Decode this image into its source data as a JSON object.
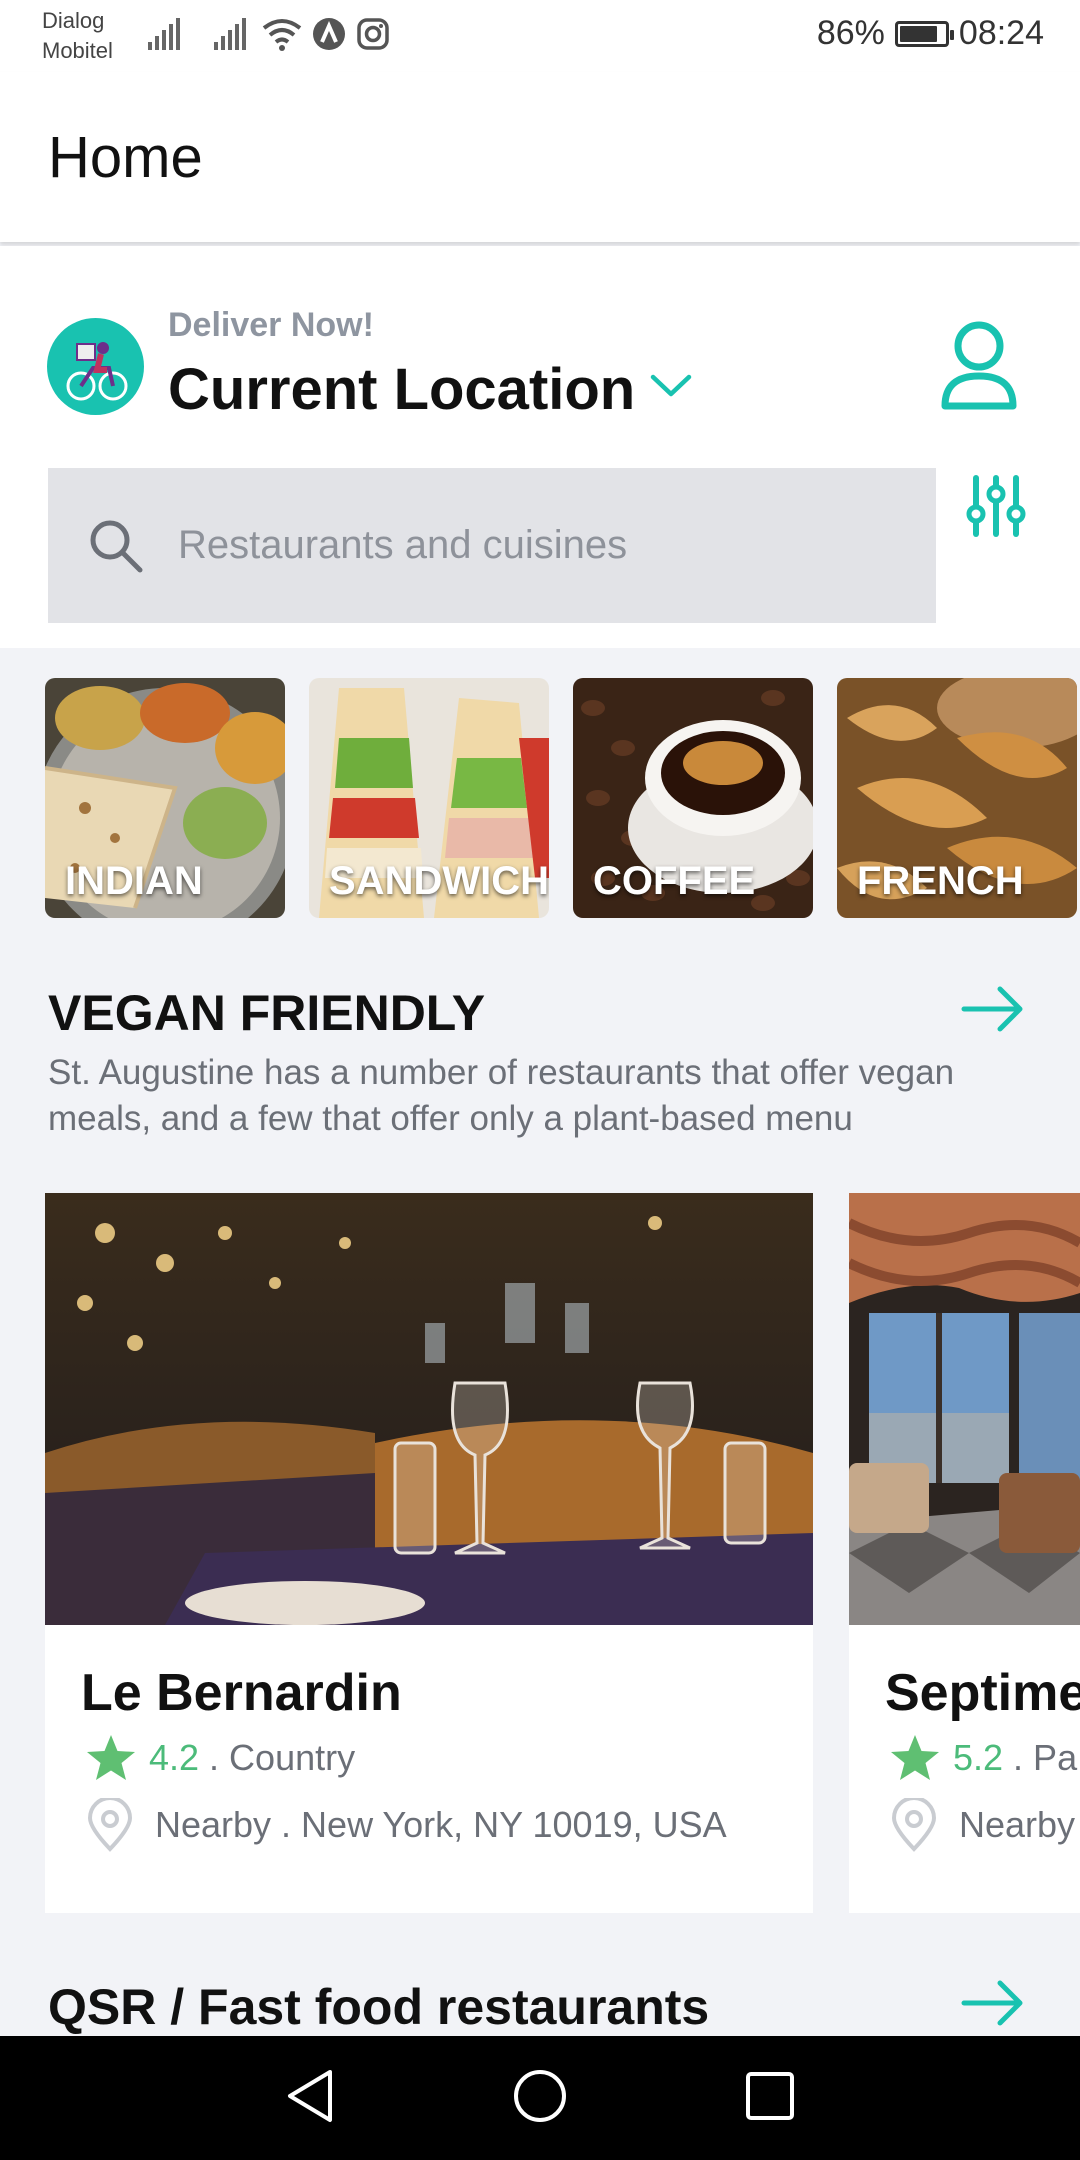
{
  "status_bar": {
    "carrier_line1": "Dialog",
    "carrier_line2": "Mobitel",
    "battery_text": "86%",
    "battery_level": 0.86,
    "time": "08:24"
  },
  "app_bar": {
    "title": "Home"
  },
  "header": {
    "deliver_label": "Deliver Now!",
    "location": "Current Location"
  },
  "search": {
    "placeholder": "Restaurants and cuisines"
  },
  "categories": [
    {
      "label": "INDIAN"
    },
    {
      "label": "SANDWICH"
    },
    {
      "label": "COFFEE"
    },
    {
      "label": "FRENCH"
    }
  ],
  "vegan_section": {
    "title": "VEGAN FRIENDLY",
    "description": "St. Augustine has a number of restaurants that offer vegan meals, and a few that offer only a plant-based menu"
  },
  "restaurants": [
    {
      "name": "Le Bernardin",
      "rating": "4.2",
      "category": ". Country",
      "location": "Nearby . New York, NY 10019, USA"
    },
    {
      "name": "Septime",
      "rating": "5.2",
      "category": ". Pa",
      "location": "Nearby"
    }
  ],
  "fastfood_section": {
    "title": "QSR / Fast food restaurants"
  },
  "colors": {
    "accent": "#19c2b0",
    "rating_green": "#4cbb7a",
    "muted_text": "#6b6f77",
    "search_bg": "#e2e3e7",
    "page_bg": "#f2f3f7"
  },
  "icons": {
    "search": "search-icon",
    "filter": "sliders-icon",
    "profile": "person-icon",
    "arrow": "arrow-right-icon",
    "star": "star-icon",
    "location": "map-pin-icon",
    "chevron": "chevron-down-icon"
  }
}
